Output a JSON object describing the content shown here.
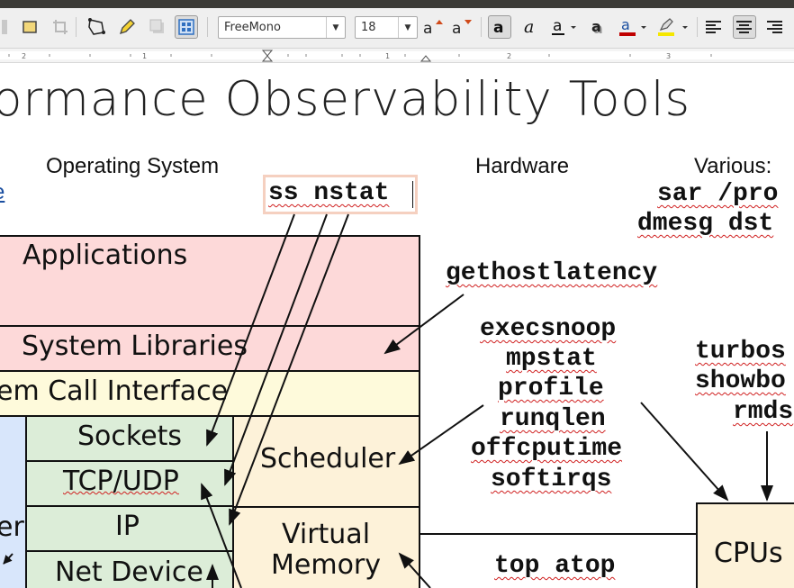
{
  "toolbar": {
    "font_name": "FreeMono",
    "font_size": "18",
    "icons": [
      "shape-fill-icon",
      "crop-icon",
      "polygon-icon",
      "highlight-pen-icon",
      "shadow-icon",
      "toggle-points-icon",
      "grow-font-icon",
      "shrink-font-icon",
      "bold-icon",
      "italic-icon",
      "underline-icon",
      "shadow-text-icon",
      "font-color-icon",
      "highlight-color-icon",
      "align-left-icon",
      "align-center-icon",
      "align-right-icon"
    ],
    "font_color": "#c00000",
    "highlight_color": "#f5e700"
  },
  "slide": {
    "title": "ormance Observability Tools",
    "headers": {
      "os": "Operating System",
      "hardware": "Hardware",
      "various": "Various:",
      "left_cut": "e"
    },
    "tools": {
      "ss_nstat": "ss nstat",
      "sar_proc": "sar /pro",
      "dmesg_dst": "dmesg dst",
      "gethostlatency": "gethostlatency",
      "execsnoop": "execsnoop",
      "mpstat": "mpstat",
      "profile": "profile",
      "runqlen": "runqlen",
      "offcputime": "offcputime",
      "softirqs": "softirqs",
      "turbos": "turbos",
      "showbo": "showbo",
      "rmds": "rmds",
      "top_atop": "top atop"
    },
    "layers": {
      "applications": "Applications",
      "system_libraries": "System Libraries",
      "syscall_interface": "em Call Interface",
      "sockets": "Sockets",
      "tcp_udp": "TCP/UDP",
      "ip": "IP",
      "net_device": "Net Device",
      "scheduler": "Scheduler",
      "virtual_memory_1": "Virtual",
      "virtual_memory_2": "Memory",
      "left_cut": "er",
      "cpus": "CPUs"
    },
    "colors": {
      "app_pink": "#fdd9d9",
      "syscall_yellow": "#fefadb",
      "net_green": "#dcedd8",
      "kernel_beige": "#fdf2d9",
      "left_blue": "#d8e6fb"
    }
  }
}
